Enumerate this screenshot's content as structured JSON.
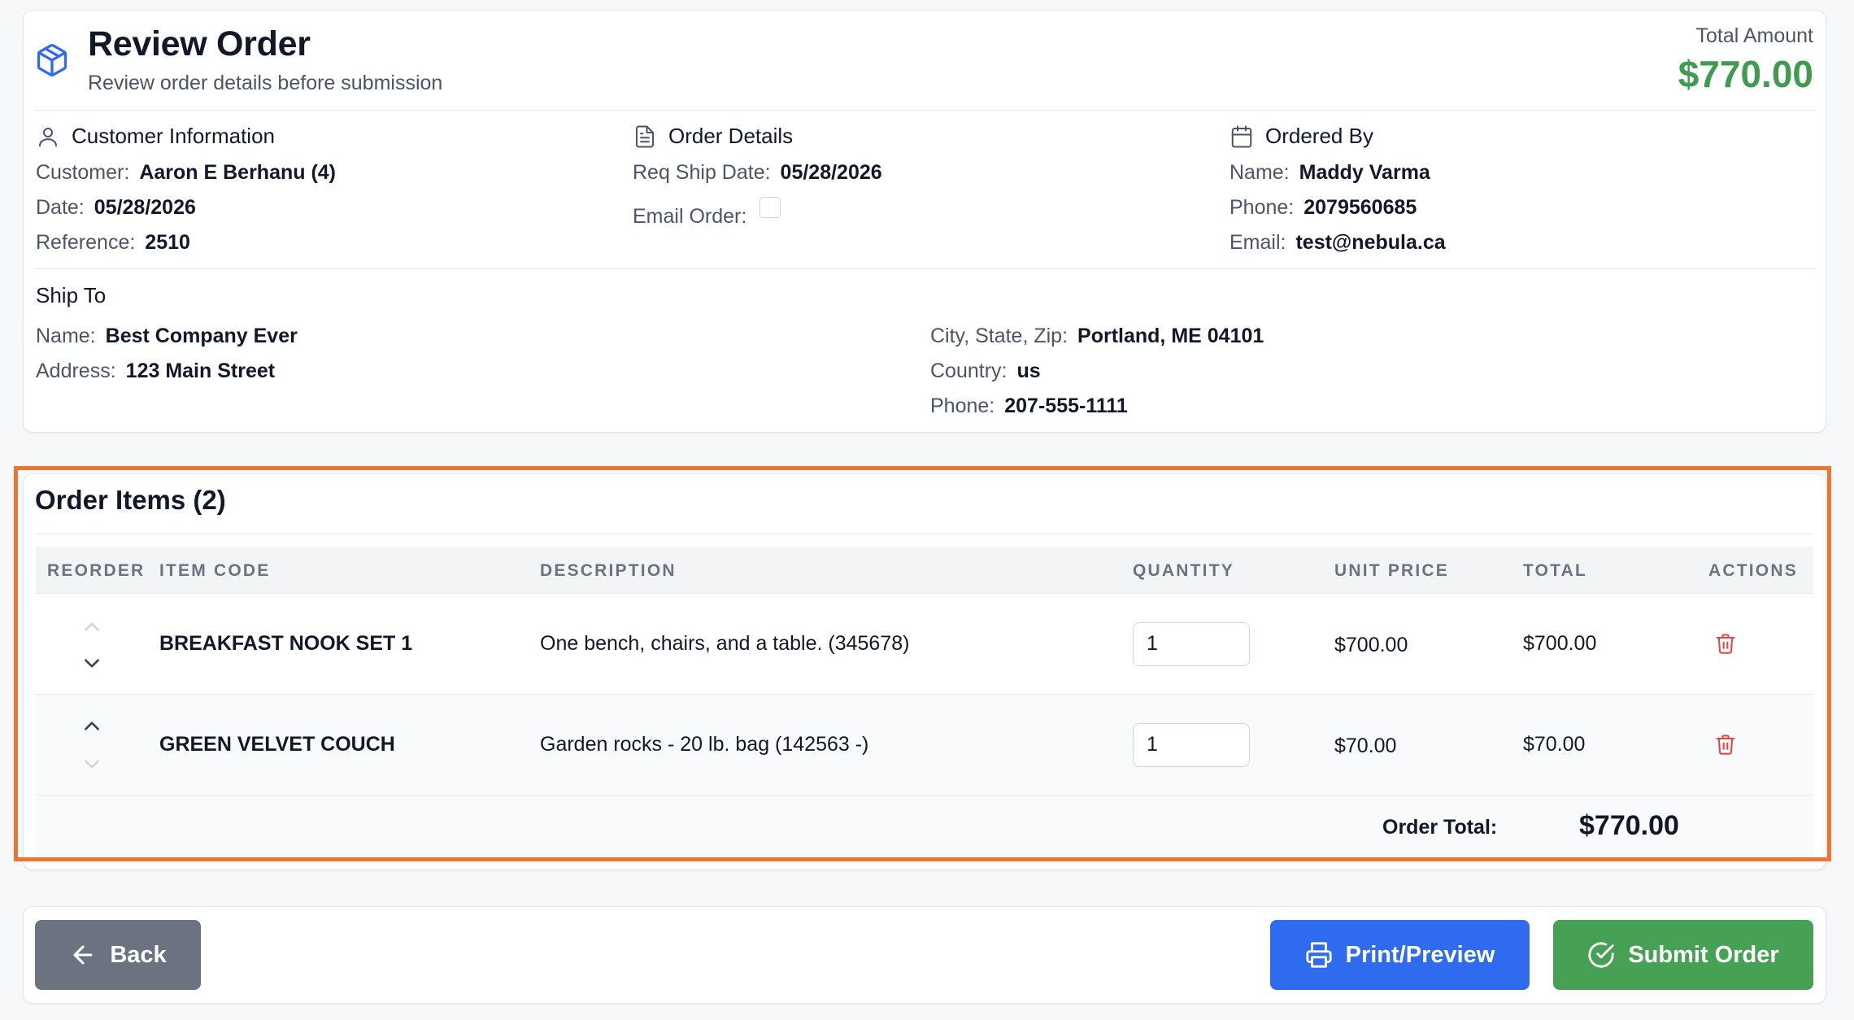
{
  "header": {
    "title": "Review Order",
    "subtitle": "Review order details before submission",
    "total_label": "Total Amount",
    "total_value": "$770.00"
  },
  "customer_info": {
    "heading": "Customer Information",
    "icon": "user-icon",
    "customer_label": "Customer:",
    "customer_value": "Aaron E Berhanu (4)",
    "date_label": "Date:",
    "date_value": "05/28/2026",
    "reference_label": "Reference:",
    "reference_value": "2510"
  },
  "order_details": {
    "heading": "Order Details",
    "icon": "document-icon",
    "ship_date_label": "Req Ship Date:",
    "ship_date_value": "05/28/2026",
    "email_order_label": "Email Order:",
    "email_order_checked": false
  },
  "ordered_by": {
    "heading": "Ordered By",
    "icon": "calendar-icon",
    "name_label": "Name:",
    "name_value": "Maddy Varma",
    "phone_label": "Phone:",
    "phone_value": "2079560685",
    "email_label": "Email:",
    "email_value": "test@nebula.ca"
  },
  "ship_to": {
    "heading": "Ship To",
    "name_label": "Name:",
    "name_value": "Best Company Ever",
    "address_label": "Address:",
    "address_value": "123 Main Street",
    "city_label": "City, State, Zip:",
    "city_value": "Portland, ME 04101",
    "country_label": "Country:",
    "country_value": "us",
    "phone_label": "Phone:",
    "phone_value": "207-555-1111"
  },
  "items": {
    "title": "Order Items (2)",
    "columns": [
      "REORDER",
      "ITEM CODE",
      "DESCRIPTION",
      "QUANTITY",
      "UNIT PRICE",
      "TOTAL",
      "ACTIONS"
    ],
    "rows": [
      {
        "code": "BREAKFAST NOOK SET 1",
        "description": "One bench, chairs, and a table. (345678)",
        "quantity": "1",
        "unit_price": "$700.00",
        "total": "$700.00",
        "up_enabled": false,
        "down_enabled": true
      },
      {
        "code": "GREEN VELVET COUCH",
        "description": "Garden rocks - 20 lb. bag (142563 -)",
        "quantity": "1",
        "unit_price": "$70.00",
        "total": "$70.00",
        "up_enabled": true,
        "down_enabled": false
      }
    ],
    "order_total_label": "Order Total:",
    "order_total_value": "$770.00"
  },
  "footer": {
    "back_label": "Back",
    "print_label": "Print/Preview",
    "submit_label": "Submit Order"
  },
  "colors": {
    "accent_green": "#3f9c4f",
    "print_blue": "#2f6bef",
    "submit_green": "#47a154",
    "back_gray": "#6b7280",
    "highlight_orange": "#ee7531",
    "trash_red": "#e04848"
  }
}
